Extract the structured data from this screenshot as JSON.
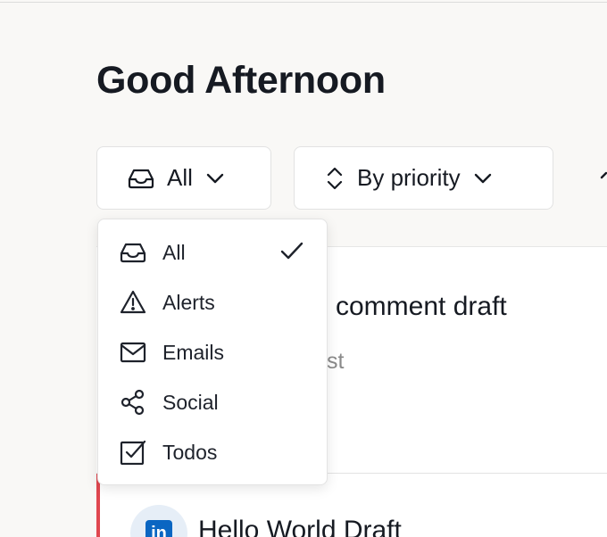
{
  "page": {
    "title": "Good Afternoon"
  },
  "toolbar": {
    "filter": {
      "label": "All",
      "icon": "inbox-icon"
    },
    "sort": {
      "label": "By priority",
      "icon": "sort-arrows-icon"
    }
  },
  "filter_menu": {
    "selected": "All",
    "items": [
      {
        "label": "All",
        "icon": "inbox-icon",
        "selected": true
      },
      {
        "label": "Alerts",
        "icon": "alert-triangle-icon",
        "selected": false
      },
      {
        "label": "Emails",
        "icon": "mail-icon",
        "selected": false
      },
      {
        "label": "Social",
        "icon": "share-icon",
        "selected": false
      },
      {
        "label": "Todos",
        "icon": "checkbox-icon",
        "selected": false
      }
    ]
  },
  "feed": {
    "cards": [
      {
        "title": "comment draft",
        "subtitle": "st"
      },
      {
        "title": "Hello World Draft",
        "source_icon": "linkedin-icon",
        "logo_text": "in",
        "accent_color": "#e0474f"
      }
    ]
  }
}
